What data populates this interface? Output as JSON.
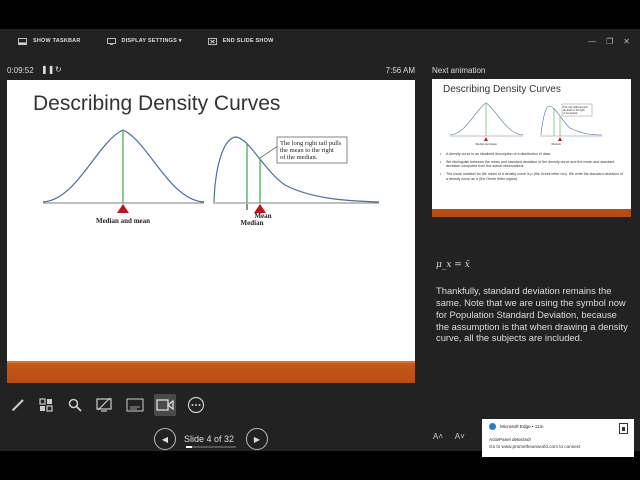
{
  "topbar": {
    "show_taskbar": "SHOW TASKBAR",
    "display_settings": "DISPLAY SETTINGS ▾",
    "end_slide_show": "END SLIDE SHOW"
  },
  "presenter": {
    "timer": "0:09:52",
    "clock": "7:56 AM",
    "slide_counter": "Slide 4 of 32",
    "progress_fraction": 0.125
  },
  "slide": {
    "title": "Describing Density Curves",
    "curve1_label": "Median and mean",
    "curve2_callout": [
      "The long right tail pulls",
      "the mean to the right",
      "of the median."
    ],
    "curve2_mean_label": "Mean",
    "curve2_median_label": "Median",
    "accent_color": "#b84d12"
  },
  "next_panel": {
    "label": "Next animation",
    "thumb_title": "Describing Density Curves",
    "thumb_bullets": [
      "A density curve is an idealized description of a distribution of data.",
      "We distinguish between the mean and standard deviation of the density curve and the mean and standard deviation computed from the actual observations.",
      "The usual notation for the mean of a density curve is μ (the Greek letter mu). We write the standard deviation of a density curve as σ (the Greek letter sigma)."
    ],
    "thumb_curve1_label": "Median and mean",
    "thumb_curve2_label": "Median",
    "thumb_callout": [
      "The long right tail pulls",
      "the mean to the right",
      "of the median."
    ]
  },
  "notes": {
    "formula": "μ_x = x̄",
    "text": "Thankfully, standard deviation remains the same. Note that we are using the symbol now for Population Standard Deviation, because the assumption is that when drawing a density curve, all the subjects are included."
  },
  "toast": {
    "app": "Microsoft Edge  •  11m",
    "line1": "ActivPanel detected!",
    "line2": "Go to www.prometheanworld.com to connect"
  },
  "icons": {
    "pen": "pen-icon",
    "see_all": "grid-icon",
    "zoom": "search-icon",
    "black_screen": "black-screen-icon",
    "subtitles": "subtitles-icon",
    "camera": "camera-icon",
    "more": "more-icon"
  }
}
